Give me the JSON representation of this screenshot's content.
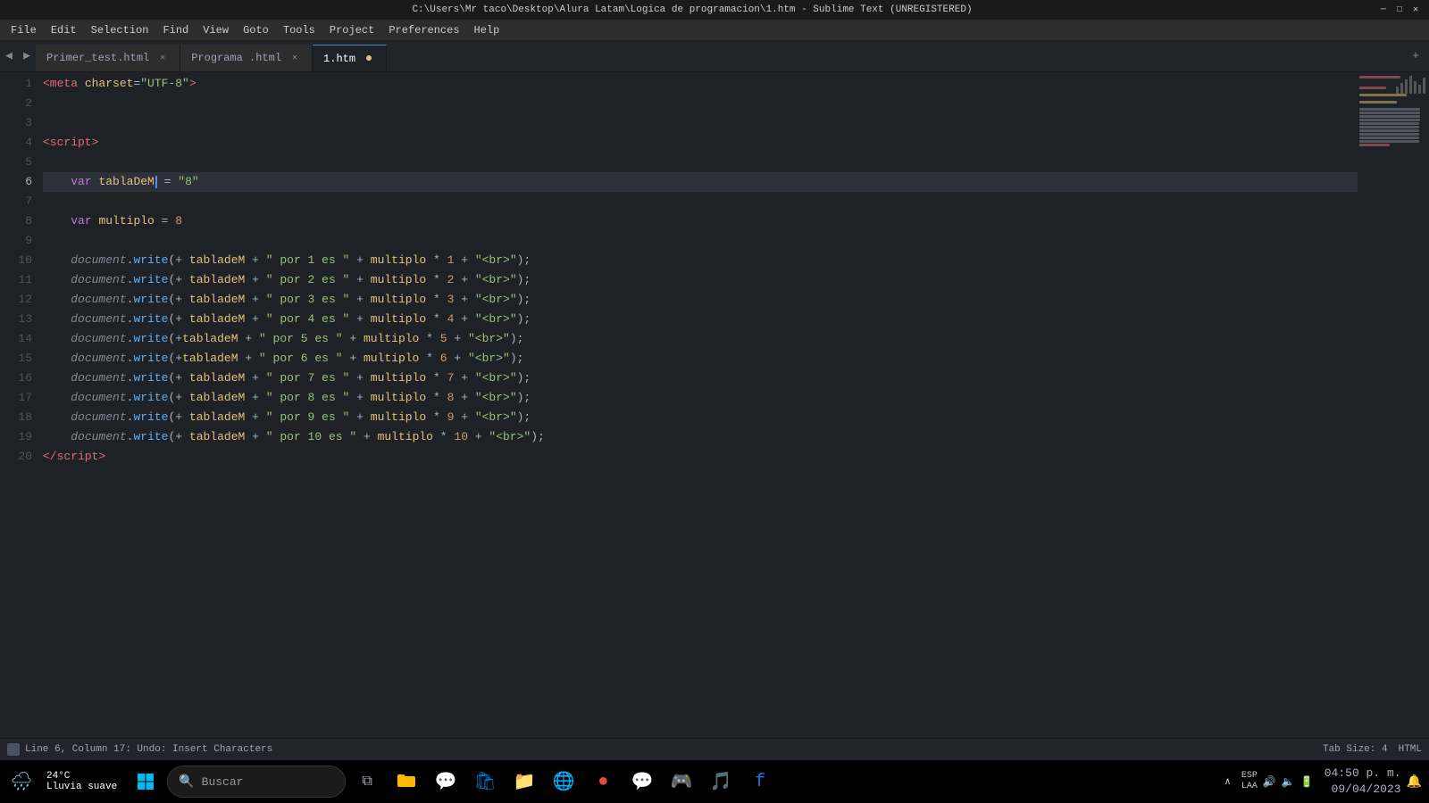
{
  "titlebar": {
    "title": "C:\\Users\\Mr taco\\Desktop\\Alura Latam\\Logica de programacion\\1.htm - Sublime Text (UNREGISTERED)",
    "minimize": "─",
    "maximize": "□",
    "close": "✕"
  },
  "menubar": {
    "items": [
      "File",
      "Edit",
      "Selection",
      "Find",
      "View",
      "Goto",
      "Tools",
      "Project",
      "Preferences",
      "Help"
    ]
  },
  "tabs": [
    {
      "label": "Primer_test.html",
      "active": false,
      "close": "✕"
    },
    {
      "label": "Programa .html",
      "active": false,
      "close": "✕"
    },
    {
      "label": "1.htm",
      "active": true,
      "close": "●"
    }
  ],
  "statusbar": {
    "left": "Line 6, Column 17: Undo: Insert Characters",
    "tabsize": "Tab Size: 4",
    "language": "HTML"
  },
  "taskbar": {
    "weather_temp": "24°C",
    "weather_desc": "Lluvia suave",
    "search_placeholder": "Buscar",
    "time": "04:50 p. m.",
    "date": "09/04/2023",
    "lang_main": "ESP",
    "lang_sub": "LAA"
  },
  "lines": [
    {
      "num": 1,
      "content": ""
    },
    {
      "num": 2,
      "content": ""
    },
    {
      "num": 3,
      "content": ""
    },
    {
      "num": 4,
      "content": ""
    },
    {
      "num": 5,
      "content": ""
    },
    {
      "num": 6,
      "content": ""
    },
    {
      "num": 7,
      "content": ""
    },
    {
      "num": 8,
      "content": ""
    },
    {
      "num": 9,
      "content": ""
    },
    {
      "num": 10,
      "content": ""
    },
    {
      "num": 11,
      "content": ""
    },
    {
      "num": 12,
      "content": ""
    },
    {
      "num": 13,
      "content": ""
    },
    {
      "num": 14,
      "content": ""
    },
    {
      "num": 15,
      "content": ""
    },
    {
      "num": 16,
      "content": ""
    },
    {
      "num": 17,
      "content": ""
    },
    {
      "num": 18,
      "content": ""
    },
    {
      "num": 19,
      "content": ""
    },
    {
      "num": 20,
      "content": ""
    }
  ]
}
